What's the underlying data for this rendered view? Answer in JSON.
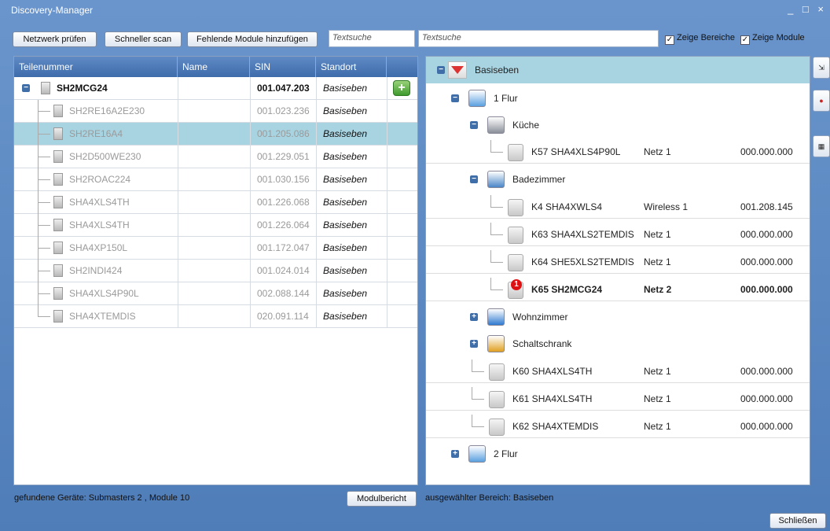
{
  "window": {
    "title": "Discovery-Manager",
    "controls": "_ □ ×"
  },
  "toolbar": {
    "check_network": "Netzwerk prüfen",
    "fast_scan": "Schneller scan",
    "add_missing": "Fehlende Module hinzufügen",
    "left_search_placeholder": "Textsuche",
    "right_search_placeholder": "Textsuche",
    "show_areas_label": "Zeige Bereiche",
    "show_modules_label": "Zeige Module"
  },
  "grid": {
    "columns": [
      "Teilenummer",
      "Name",
      "SIN",
      "Standort"
    ],
    "rows": [
      {
        "part": "SH2MCG24",
        "name": "",
        "sin": "001.047.203",
        "location": "Basiseben"
      },
      {
        "part": "SH2RE16A2E230",
        "name": "",
        "sin": "001.023.236",
        "location": "Basiseben"
      },
      {
        "part": "SH2RE16A4",
        "name": "",
        "sin": "001.205.086",
        "location": "Basiseben"
      },
      {
        "part": "SH2D500WE230",
        "name": "",
        "sin": "001.229.051",
        "location": "Basiseben"
      },
      {
        "part": "SH2ROAC224",
        "name": "",
        "sin": "001.030.156",
        "location": "Basiseben"
      },
      {
        "part": "SHA4XLS4TH",
        "name": "",
        "sin": "001.226.068",
        "location": "Basiseben"
      },
      {
        "part": "SHA4XLS4TH",
        "name": "",
        "sin": "001.226.064",
        "location": "Basiseben"
      },
      {
        "part": "SHA4XP150L",
        "name": "",
        "sin": "001.172.047",
        "location": "Basiseben"
      },
      {
        "part": "SH2INDI424",
        "name": "",
        "sin": "001.024.014",
        "location": "Basiseben"
      },
      {
        "part": "SHA4XLS4P90L",
        "name": "",
        "sin": "002.088.144",
        "location": "Basiseben"
      },
      {
        "part": "SHA4XTEMDIS",
        "name": "",
        "sin": "020.091.114",
        "location": "Basiseben"
      }
    ]
  },
  "tree": {
    "root": "Basiseben",
    "floor1": "1 Flur",
    "kitchen": "Küche",
    "k57": {
      "label": "K57 SHA4XLS4P90L",
      "net": "Netz 1",
      "sin": "000.000.000"
    },
    "bathroom": "Badezimmer",
    "k4": {
      "label": "K4 SHA4XWLS4",
      "net": "Wireless 1",
      "sin": "001.208.145"
    },
    "k63": {
      "label": "K63 SHA4XLS2TEMDIS",
      "net": "Netz 1",
      "sin": "000.000.000"
    },
    "k64": {
      "label": "K64 SHE5XLS2TEMDIS",
      "net": "Netz 1",
      "sin": "000.000.000"
    },
    "k65": {
      "label": "K65 SH2MCG24",
      "net": "Netz 2",
      "sin": "000.000.000",
      "badge": "1"
    },
    "living": "Wohnzimmer",
    "cabinet": "Schaltschrank",
    "k60": {
      "label": "K60 SHA4XLS4TH",
      "net": "Netz 1",
      "sin": "000.000.000"
    },
    "k61": {
      "label": "K61 SHA4XLS4TH",
      "net": "Netz 1",
      "sin": "000.000.000"
    },
    "k62": {
      "label": "K62 SHA4XTEMDIS",
      "net": "Netz 1",
      "sin": "000.000.000"
    },
    "floor2": "2 Flur"
  },
  "status": {
    "found_devices": "gefundene Geräte: Submasters 2 , Module 10",
    "module_report": "Modulbericht",
    "selected_area": "ausgewählter Bereich: Basiseben",
    "close": "Schließen"
  },
  "colors": {
    "header": "#3e6bab",
    "selection": "#a8d4e2",
    "window": "#5b86bd"
  }
}
